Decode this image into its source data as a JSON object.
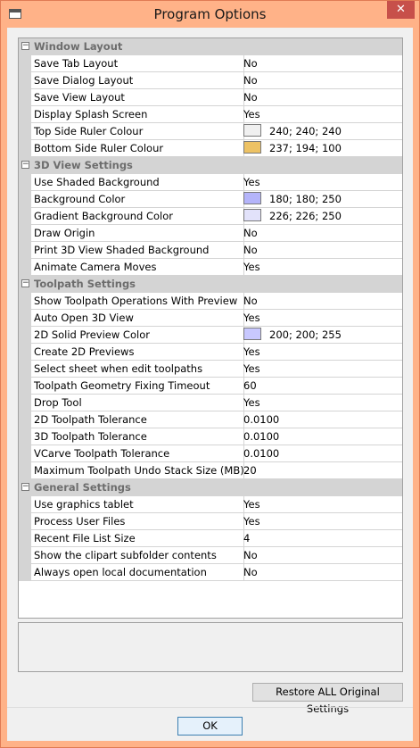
{
  "window": {
    "title": "Program Options",
    "close_glyph": "✕"
  },
  "grid": {
    "sections": [
      {
        "label": "Window Layout",
        "toggle": "−",
        "rows": [
          {
            "name": "Save Tab Layout",
            "value": "No"
          },
          {
            "name": "Save Dialog Layout",
            "value": "No"
          },
          {
            "name": "Save View Layout",
            "value": "No"
          },
          {
            "name": "Display Splash Screen",
            "value": "Yes"
          },
          {
            "name": "Top Side Ruler Colour",
            "value": "240; 240; 240",
            "swatch": "#f0f0f0"
          },
          {
            "name": "Bottom Side Ruler Colour",
            "value": "237; 194; 100",
            "swatch": "#edc264"
          }
        ]
      },
      {
        "label": "3D View Settings",
        "toggle": "−",
        "rows": [
          {
            "name": "Use Shaded Background",
            "value": "Yes"
          },
          {
            "name": "Background Color",
            "value": "180; 180; 250",
            "swatch": "#b4b4fa"
          },
          {
            "name": "Gradient Background Color",
            "value": "226; 226; 250",
            "swatch": "#e2e2fa"
          },
          {
            "name": "Draw Origin",
            "value": "No"
          },
          {
            "name": "Print 3D View Shaded Background",
            "value": "No"
          },
          {
            "name": "Animate Camera Moves",
            "value": "Yes"
          }
        ]
      },
      {
        "label": "Toolpath Settings",
        "toggle": "−",
        "rows": [
          {
            "name": "Show Toolpath Operations With Preview",
            "value": "No"
          },
          {
            "name": "Auto Open 3D View",
            "value": "Yes"
          },
          {
            "name": "2D Solid Preview Color",
            "value": "200; 200; 255",
            "swatch": "#c8c8ff"
          },
          {
            "name": "Create 2D Previews",
            "value": "Yes"
          },
          {
            "name": "Select sheet when edit toolpaths",
            "value": "Yes"
          },
          {
            "name": "Toolpath Geometry Fixing Timeout",
            "value": "60"
          },
          {
            "name": "Drop Tool",
            "value": "Yes"
          },
          {
            "name": "2D Toolpath Tolerance",
            "value": "0.0100"
          },
          {
            "name": "3D Toolpath Tolerance",
            "value": "0.0100"
          },
          {
            "name": "VCarve Toolpath Tolerance",
            "value": "0.0100"
          },
          {
            "name": "Maximum Toolpath Undo Stack Size (MB)",
            "value": "20"
          }
        ]
      },
      {
        "label": "General Settings",
        "toggle": "−",
        "rows": [
          {
            "name": "Use graphics tablet",
            "value": "Yes"
          },
          {
            "name": "Process User Files",
            "value": "Yes"
          },
          {
            "name": "Recent File List Size",
            "value": "4"
          },
          {
            "name": "Show the clipart subfolder contents",
            "value": "No"
          },
          {
            "name": "Always open local documentation",
            "value": "No"
          }
        ]
      }
    ]
  },
  "buttons": {
    "restore": "Restore ALL Original Settings",
    "ok": "OK"
  }
}
